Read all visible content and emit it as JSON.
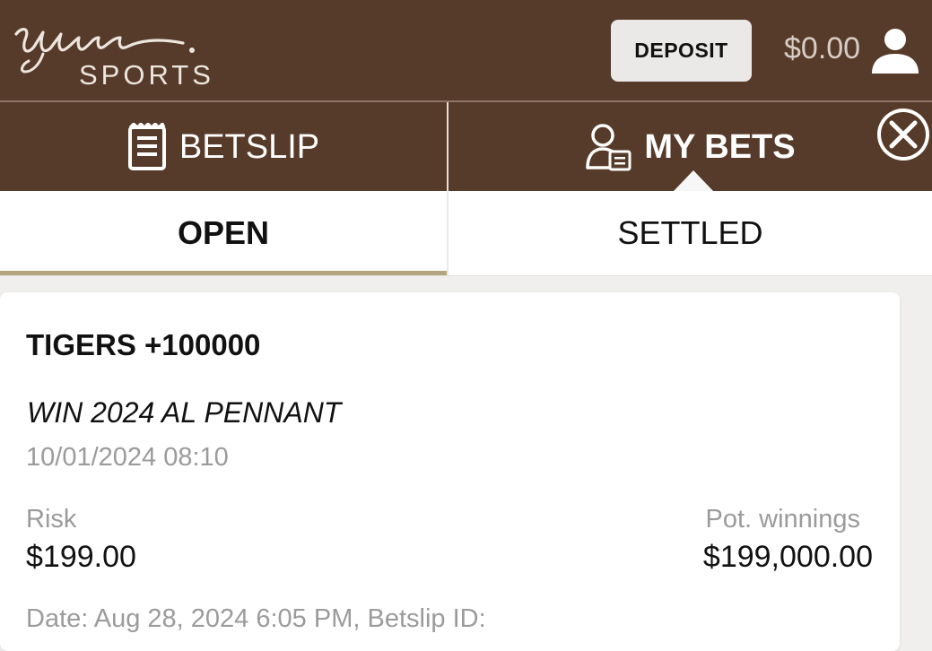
{
  "header": {
    "logo": {
      "script_text": "Wynn.",
      "subtext": "SPORTS"
    },
    "deposit_label": "DEPOSIT",
    "balance": "$0.00",
    "icons": {
      "user": "user-icon"
    },
    "colors": {
      "background": "#573b2a",
      "logo": "#ece6df"
    }
  },
  "tabs": {
    "betslip": {
      "label": "BETSLIP",
      "icon": "clipboard-icon"
    },
    "my_bets": {
      "label": "MY BETS",
      "icon": "user-badge-icon",
      "active": true
    },
    "close_icon": "close-icon"
  },
  "subtabs": {
    "open": {
      "label": "OPEN",
      "active": true
    },
    "settled": {
      "label": "SETTLED"
    },
    "accent_color": "#b3a57e"
  },
  "bet": {
    "title": "TIGERS +100000",
    "market": "WIN 2024 AL PENNANT",
    "event_date": "10/01/2024 08:10",
    "risk_label": "Risk",
    "risk_value": "$199.00",
    "winnings_label": "Pot. winnings",
    "winnings_value": "$199,000.00",
    "footer": "Date: Aug 28, 2024 6:05 PM, Betslip ID:"
  }
}
